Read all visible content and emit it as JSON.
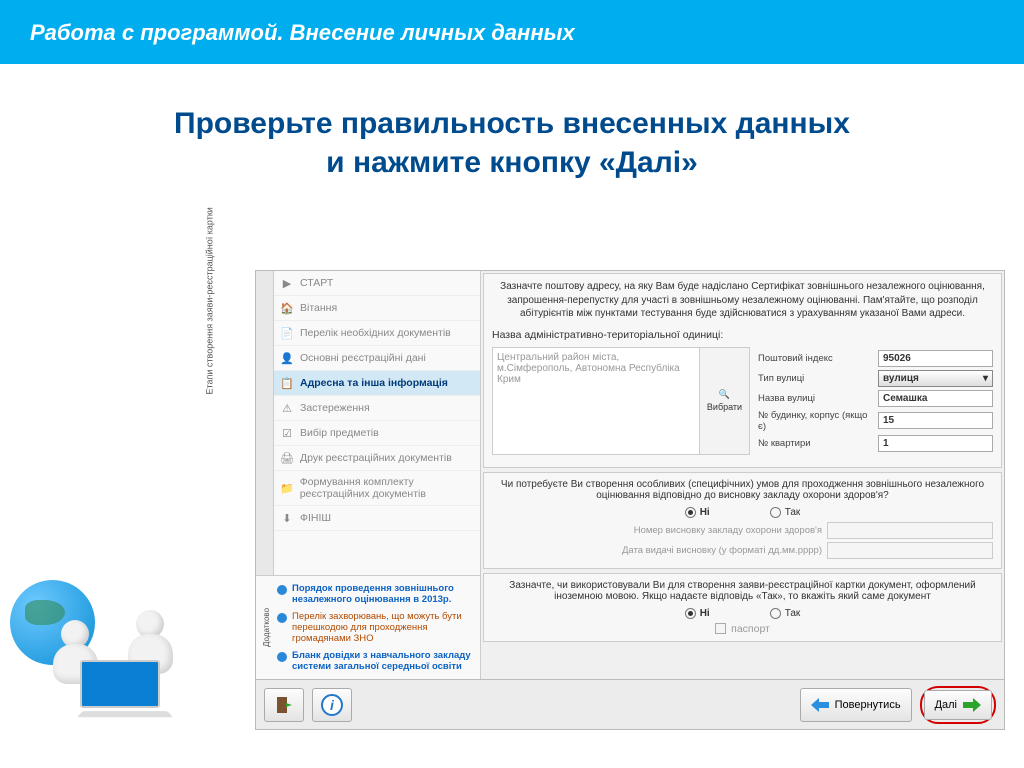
{
  "banner": "Работа с программой. Внесение личных данных",
  "heading_l1": "Проверьте правильность внесенных данных",
  "heading_l2": "и нажмите кнопку «Далі»",
  "sidebar": {
    "vtab": "Етапи створення заяви-реєстраційної картки",
    "items": [
      {
        "label": "СТАРТ"
      },
      {
        "label": "Вітання"
      },
      {
        "label": "Перелік необхідних документів"
      },
      {
        "label": "Основні реєстраційні дані"
      },
      {
        "label": "Адресна та інша інформація"
      },
      {
        "label": "Застереження"
      },
      {
        "label": "Вибір предметів"
      },
      {
        "label": "Друк реєстраційних документів"
      },
      {
        "label": "Формування комплекту реєстраційних документів"
      },
      {
        "label": "ФІНІШ"
      }
    ],
    "extra_title": "Додатково",
    "links": [
      {
        "label": "Порядок проведення зовнішнього незалежного оцінювання  в 2013р."
      },
      {
        "label": "Перелік захворювань, що можуть бути перешкодою для проходження громадянами ЗНО"
      },
      {
        "label": "Бланк довідки з навчального закладу системи загальної середньої освіти"
      }
    ]
  },
  "mainpanel": {
    "instr": "Зазначте поштову адресу, на яку Вам буде надіслано Сертифікат зовнішнього незалежного оцінювання, запрошення-перепустку для участі в зовнішньому незалежному оцінюванні.  Пам'ятайте, що розподіл абітурієнтів між пунктами тестування буде здійснюватися з урахуванням указаної Вами адреси.",
    "addr_label": "Назва адміністративно-територіальної одиниці:",
    "addr_value": "Центральний район міста, м.Сімферополь, Автономна Республіка Крим",
    "addr_btn": "Вибрати",
    "fields": {
      "zip_l": "Поштовий індекс",
      "zip_v": "95026",
      "sttype_l": "Тип вулиці",
      "sttype_v": "вулиця",
      "stname_l": "Назва вулиці",
      "stname_v": "Семашка",
      "house_l": "№ будинку, корпус (якщо є)",
      "house_v": "15",
      "apt_l": "№ квартири",
      "apt_v": "1"
    },
    "q1": "Чи потребуєте Ви створення особливих (специфічних) умов для проходження зовнішнього незалежного оцінювання відповідно до висновку закладу охорони здоров'я?",
    "opt_no": "Ні",
    "opt_yes": "Так",
    "q1_sub1": "Номер висновку закладу охорони здоров'я",
    "q1_sub2": "Дата видачі висновку (у форматі дд.мм.рррр)",
    "q2": "Зазначте, чи використовували Ви для створення заяви-реєстраційної картки документ, оформлений іноземною мовою. Якщо надаєте відповідь «Так», то вкажіть який саме документ",
    "q2_chk": "паспорт"
  },
  "toolbar": {
    "back": "Повернутись",
    "next": "Далі"
  }
}
